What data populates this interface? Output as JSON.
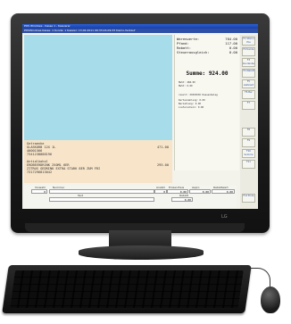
{
  "window": {
    "title": "POS Windows - Kasse 1 - Kassierer",
    "menu": "POSWindows    Kasse: 1   Kunde: 1   Kassier: 13.02.2011 09:33:24-09:33 Demo-Verkauf"
  },
  "summary": {
    "rows": [
      {
        "label": "Warenwerte:",
        "value": "784.00"
      },
      {
        "label": "Pfand:",
        "value": "117.00"
      },
      {
        "label": "Rabatt:",
        "value": "0.00"
      },
      {
        "label": "Steuerausgleich:",
        "value": "0.00"
      }
    ],
    "total_label": "Summe:",
    "total_value": "924.00",
    "tax_rows": [
      "MwSt: 468.00",
      "MwSt: 0.00"
    ],
    "info_rows": [
      "result: XXXXXXXX Kassenbeleg",
      "Kartenzahlung: 0.00",
      "Barzahlung: 0.00",
      "Lieferschein: 0.00"
    ]
  },
  "function_keys": [
    "F1 Storno Pos",
    "F2 Kunde",
    "F3 Kundenbez.",
    "F4 Rabatt",
    "F5 Lieferant",
    "F6 Bar",
    "F7",
    "F8",
    "F9",
    "F10 Summe",
    "F11",
    "F12 Ende"
  ],
  "line_items": [
    {
      "text": "Getraenke",
      "price": ""
    },
    {
      "text": "GLASKORB 12X 1L",
      "price": "471.00"
    },
    {
      "text": "40001566",
      "price": ""
    },
    {
      "text": "7341238888196",
      "price": ""
    },
    {
      "text": "",
      "price": ""
    },
    {
      "text": "Antialkohol",
      "price": ""
    },
    {
      "text": "ERDBEERDRINK 250ML 6ER",
      "price": "295.00"
    },
    {
      "text": "ZITRUS GEDRINK EXTRA STARK 8ER ZUM FRI",
      "price": ""
    },
    {
      "text": "7317296813042",
      "price": ""
    }
  ],
  "input_area": {
    "headers": [
      "Vorwahl",
      "Nummer",
      "Anzahl",
      "Einzel-Preis",
      "Aspro",
      "Rabattwert"
    ],
    "quantity": "0",
    "price": "0.00",
    "aspro": "0.00",
    "rabatt": "0.00",
    "text_label": "Text",
    "extra_label": "Rabatt",
    "extra_value": "0.00"
  },
  "bezel": {
    "brand": "LG"
  }
}
